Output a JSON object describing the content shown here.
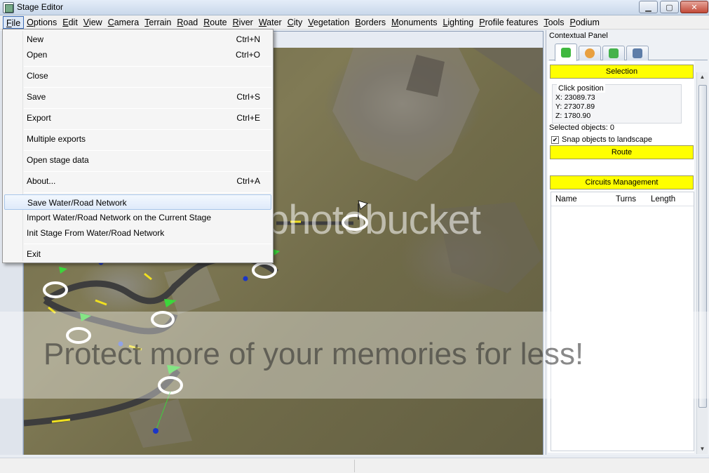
{
  "window": {
    "title": "Stage Editor"
  },
  "menubar": [
    "File",
    "Options",
    "Edit",
    "View",
    "Camera",
    "Terrain",
    "Road",
    "Route",
    "River",
    "Water",
    "City",
    "Vegetation",
    "Borders",
    "Monuments",
    "Lighting",
    "Profile features",
    "Tools",
    "Podium"
  ],
  "file_menu": {
    "new": {
      "label": "New",
      "shortcut": "Ctrl+N"
    },
    "open": {
      "label": "Open",
      "shortcut": "Ctrl+O"
    },
    "close": {
      "label": "Close"
    },
    "save": {
      "label": "Save",
      "shortcut": "Ctrl+S"
    },
    "export": {
      "label": "Export",
      "shortcut": "Ctrl+E"
    },
    "multiple_exports": {
      "label": "Multiple exports"
    },
    "open_stage_data": {
      "label": "Open stage data"
    },
    "about": {
      "label": "About...",
      "shortcut": "Ctrl+A"
    },
    "save_network": {
      "label": "Save Water/Road Network"
    },
    "import_network": {
      "label": "Import Water/Road Network on the Current Stage"
    },
    "init_stage": {
      "label": "Init Stage From Water/Road Network"
    },
    "exit": {
      "label": "Exit"
    }
  },
  "panel": {
    "title": "Contextual Panel",
    "selection_button": "Selection",
    "click_position_label": "Click position",
    "x": "X: 23089.73",
    "y": "Y: 27307.89",
    "z": "Z: 1780.90",
    "selected_objects": "Selected objects: 0",
    "snap_label": "Snap objects to landscape",
    "route_button": "Route",
    "circuits_button": "Circuits Management",
    "table_headers": [
      "Name",
      "Turns",
      "Length"
    ]
  },
  "watermark": {
    "line1": "photobucket",
    "line2": "Protect more of your memories for less!"
  },
  "colors": {
    "button_yellow": "#ffff00",
    "terrain": "#7a7450"
  }
}
